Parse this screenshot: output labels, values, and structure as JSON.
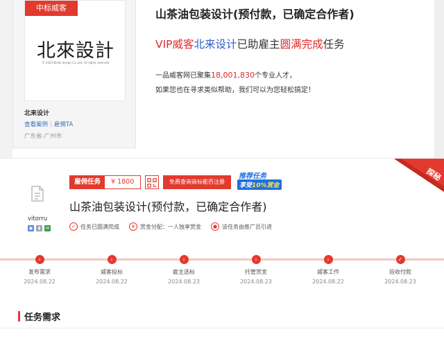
{
  "vendor": {
    "tag": "中标威客",
    "logo_text": "北來設計",
    "logo_copyright": "© 2023 Beilai design Co.,Ltd. All rights reserved",
    "name": "北来设计",
    "link_cases": "查看案例",
    "link_hire": "雇佣TA",
    "location": "广东省-广州市"
  },
  "top": {
    "title": "山茶油包装设计(预付款，已确定合作者)",
    "vip_prefix": "VIP威客",
    "vip_name": "北来设计",
    "vip_mid": "已助雇主",
    "vip_done": "圆满完成",
    "vip_suffix": "任务",
    "talent_a": "一品威客网已聚集",
    "talent_num": "18,001,830",
    "talent_b": "个专业人才，",
    "talent_line2": "如果您也在寻求类似帮助，我们可以为您轻松搞定！"
  },
  "task": {
    "user_name": "vitorru",
    "badge_label": "雇佣任务",
    "price": "¥ 1800",
    "trademark_btn": "免费查询商标能否注册",
    "promo_line1": "推荐任务",
    "promo_line2a": "享受",
    "promo_line2b": "10%赏金",
    "corner_label": "探秘",
    "title": "山茶油包装设计(预付款，已确定合作者)",
    "props": [
      {
        "icon": "check-circle-icon",
        "text": "任务已圆满完成"
      },
      {
        "icon": "reward-icon",
        "text": "赏金分配：一人独享赏金"
      },
      {
        "icon": "promoter-icon",
        "text": "该任务由推广员引进"
      }
    ],
    "steps": [
      {
        "label": "发布需求",
        "date": "2024.08.22"
      },
      {
        "label": "威客投标",
        "date": "2024.08.22"
      },
      {
        "label": "雇主选标",
        "date": "2024.08.23"
      },
      {
        "label": "托管赏金",
        "date": "2024.08.23"
      },
      {
        "label": "威客工作",
        "date": "2024.08.22"
      },
      {
        "label": "验收付款",
        "date": "2024.08.23"
      }
    ],
    "requirements_title": "任务需求"
  },
  "colors": {
    "accent": "#e23a2e",
    "link": "#3a6fb5",
    "blue": "#2f5fc7"
  }
}
